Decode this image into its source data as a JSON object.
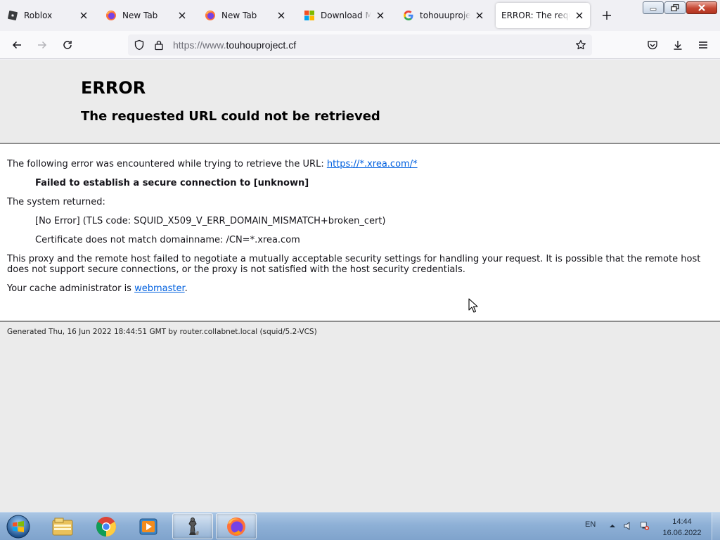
{
  "tabs": [
    {
      "title": "Roblox",
      "icon": "roblox-icon",
      "selected": false
    },
    {
      "title": "New Tab",
      "icon": "firefox-icon",
      "selected": false
    },
    {
      "title": "New Tab",
      "icon": "firefox-icon",
      "selected": false
    },
    {
      "title": "Download Micro",
      "icon": "microsoft-icon",
      "selected": false
    },
    {
      "title": "tohouuproject.x",
      "icon": "google-icon",
      "selected": false
    },
    {
      "title": "ERROR: The request",
      "icon": "none",
      "selected": true
    }
  ],
  "url": {
    "scheme": "https://www.",
    "host": "touhouproject.cf"
  },
  "error_page": {
    "h1": "ERROR",
    "h2": "The requested URL could not be retrieved",
    "following_prefix": "The following error was encountered while trying to retrieve the URL: ",
    "url_link": "https://*.xrea.com/*",
    "failed": "Failed to establish a secure connection to [unknown]",
    "system_returned": "The system returned:",
    "no_error": "[No Error] (TLS code: SQUID_X509_V_ERR_DOMAIN_MISMATCH+broken_cert)",
    "cert": "Certificate does not match domainname: /CN=*.xrea.com",
    "proxy_text": "This proxy and the remote host failed to negotiate a mutually acceptable security settings for handling your request. It is possible that the remote host does not support secure connections, or the proxy is not satisfied with the host security credentials.",
    "cache_admin_prefix": "Your cache administrator is ",
    "cache_admin_link": "webmaster",
    "cache_admin_suffix": ".",
    "generated": "Generated Thu, 16 Jun 2022 18:44:51 GMT by router.collabnet.local (squid/5.2-VCS)"
  },
  "taskbar": {
    "apps": [
      "file-explorer-icon",
      "chrome-icon",
      "media-player-icon",
      "chess-icon",
      "firefox-icon"
    ],
    "active_app": "firefox-icon",
    "language": "EN",
    "time": "14:44",
    "date": "16.06.2022"
  },
  "colors": {
    "link": "#0060df",
    "tab_strip": "#f0f0f4",
    "page_bg": "#ebebeb"
  }
}
